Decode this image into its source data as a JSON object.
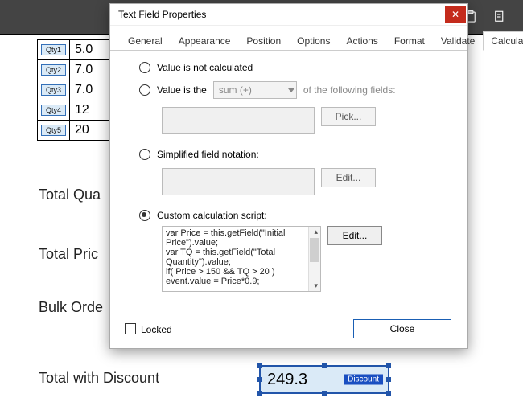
{
  "doc": {
    "qtyFields": [
      {
        "name": "Qty1",
        "value": "5.0"
      },
      {
        "name": "Qty2",
        "value": "7.0"
      },
      {
        "name": "Qty3",
        "value": "7.0"
      },
      {
        "name": "Qty4",
        "value": "12"
      },
      {
        "name": "Qty5",
        "value": "20"
      }
    ],
    "labels": {
      "totalQuantity": "Total Qua",
      "totalPrice": "Total Pric",
      "bulkOrder": "Bulk Orde",
      "totalWithDiscount": "Total with Discount"
    },
    "discount": {
      "value": "249.3",
      "tag": "Discount"
    }
  },
  "dialog": {
    "title": "Text Field Properties",
    "tabs": [
      "General",
      "Appearance",
      "Position",
      "Options",
      "Actions",
      "Format",
      "Validate",
      "Calculate"
    ],
    "activeTab": "Calculate",
    "calc": {
      "opt_notCalculated": "Value is not calculated",
      "opt_valueIs": "Value is the",
      "opt_valueIs_suffix": "of the following fields:",
      "selectLabel": "sum (+)",
      "pickBtn": "Pick...",
      "opt_simplified": "Simplified field notation:",
      "editBtn": "Edit...",
      "opt_custom": "Custom calculation script:",
      "script": "var Price = this.getField(\"Initial Price\").value;\nvar TQ = this.getField(\"Total Quantity\").value;\nif( Price > 150 && TQ > 20 )\nevent.value = Price*0.9;"
    },
    "lockedLabel": "Locked",
    "closeLabel": "Close"
  }
}
